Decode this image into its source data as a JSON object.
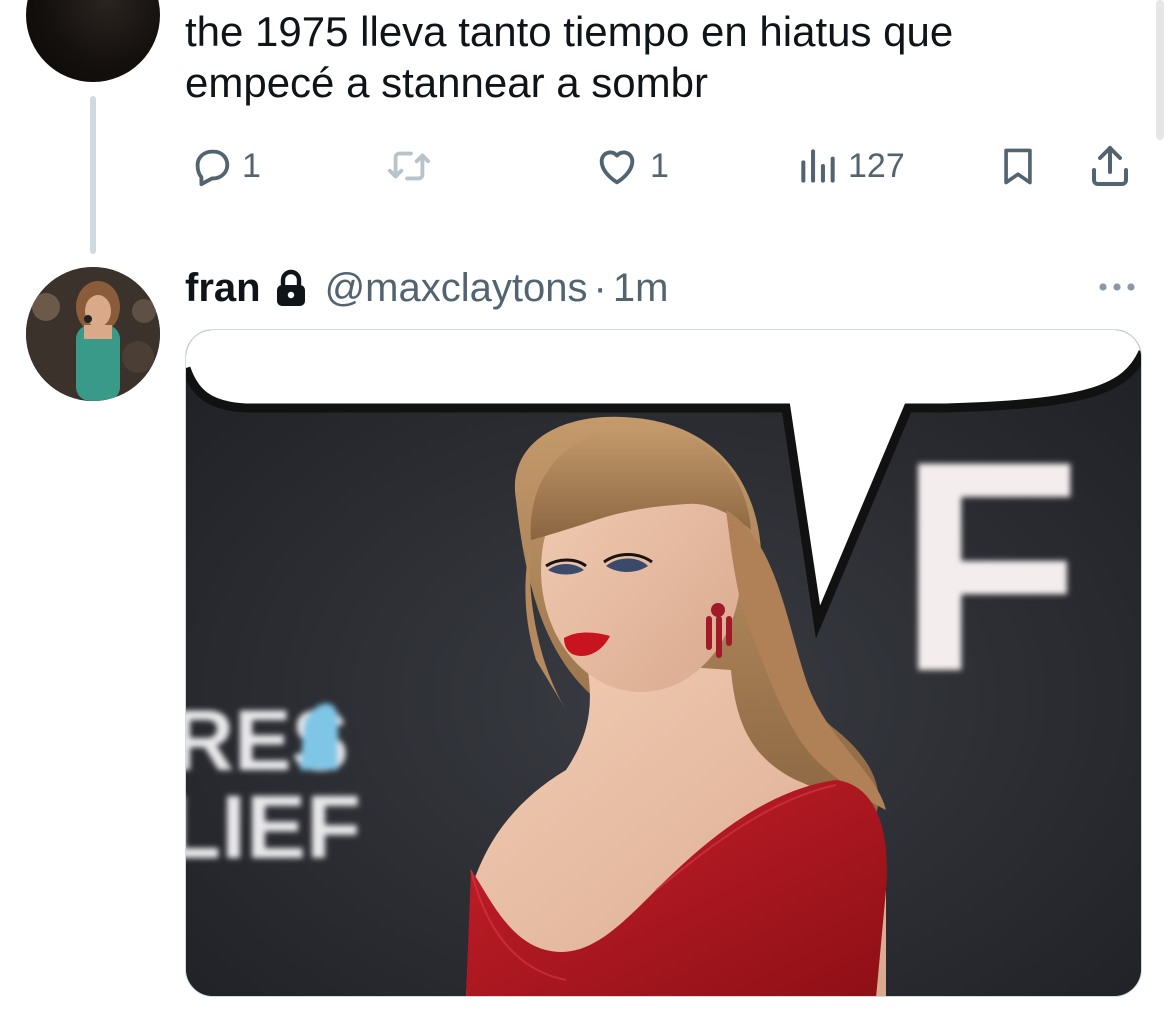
{
  "previous_tweet": {
    "text_line1": "the 1975 lleva tanto tiempo en hiatus que",
    "text_line2": "empecé a stannear a sombr",
    "reply_count": "1",
    "like_count": "1",
    "view_count": "127"
  },
  "tweet": {
    "display_name": "fran",
    "handle": "@maxclaytons",
    "separator": "·",
    "time": "1m",
    "media": {
      "backdrop_letters_left": [
        "RES",
        "LIEF"
      ],
      "backdrop_letter_right": "F"
    }
  },
  "icons": {
    "reply": "reply-icon",
    "retweet": "retweet-icon",
    "like": "heart-icon",
    "views": "bar-chart-icon",
    "bookmark": "bookmark-icon",
    "share": "share-icon",
    "lock": "lock-icon",
    "more": "more-icon"
  },
  "colors": {
    "text_primary": "#0f1419",
    "text_secondary": "#536471",
    "thread_line": "#cfd9de",
    "backdrop": "#2b2d33",
    "dress_red": "#b3141c"
  }
}
